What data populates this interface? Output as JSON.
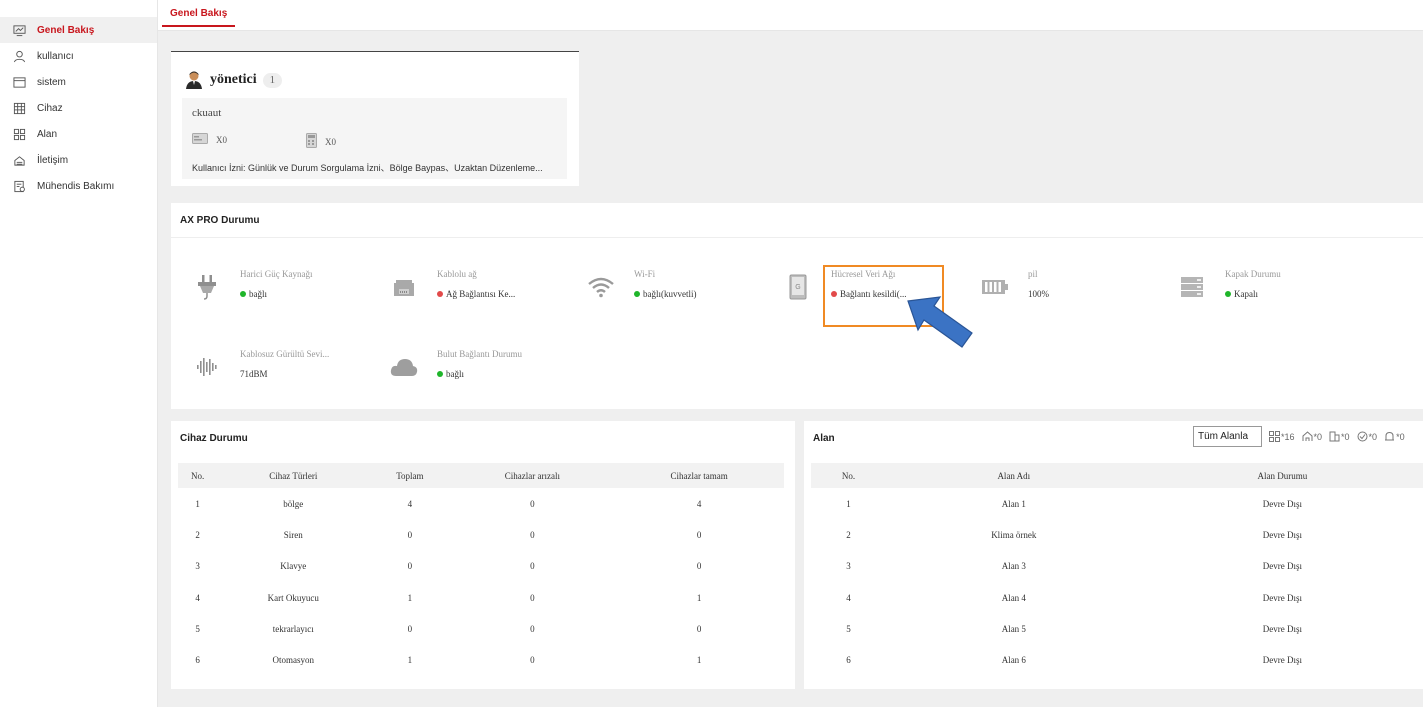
{
  "sidebar": {
    "items": [
      {
        "label": "Genel Bakış",
        "icon": "monitor-icon",
        "active": true
      },
      {
        "label": "kullanıcı",
        "icon": "user-icon"
      },
      {
        "label": "sistem",
        "icon": "window-icon"
      },
      {
        "label": "Cihaz",
        "icon": "device-icon"
      },
      {
        "label": "Alan",
        "icon": "grid-icon"
      },
      {
        "label": "İletişim",
        "icon": "communication-icon"
      },
      {
        "label": "Mühendis Bakımı",
        "icon": "maintenance-icon"
      }
    ]
  },
  "tabs": {
    "active": "Genel Bakış"
  },
  "user_card": {
    "role": "yönetici",
    "count": "1",
    "username": "ckuaut",
    "card_count": "X0",
    "keypad_count": "X0",
    "permission": "Kullanıcı İzni:  Günlük ve Durum Sorgulama İzni、Bölge Baypas、Uzaktan Düzenleme..."
  },
  "status": {
    "title": "AX PRO Durumu",
    "items": [
      {
        "label": "Harici Güç Kaynağı",
        "value": "bağlı",
        "dot": "green",
        "icon": "plug-icon"
      },
      {
        "label": "Kablolu ağ",
        "value": "Ağ Bağlantısı Ke...",
        "dot": "red",
        "icon": "ethernet-icon"
      },
      {
        "label": "Wi-Fi",
        "value": "bağlı(kuvvetli)",
        "dot": "green",
        "icon": "wifi-icon"
      },
      {
        "label": "Hücresel Veri Ağı",
        "value": "Bağlantı kesildi(...",
        "dot": "red",
        "icon": "sim-card-icon"
      },
      {
        "label": "pil",
        "value": "100%",
        "dot": "",
        "icon": "battery-icon"
      },
      {
        "label": "Kapak Durumu",
        "value": "Kapalı",
        "dot": "green",
        "icon": "cover-icon"
      },
      {
        "label": "Kablosuz Gürültü Sevi...",
        "value": "71dBM",
        "dot": "",
        "icon": "noise-icon"
      },
      {
        "label": "Bulut Bağlantı Durumu",
        "value": "bağlı",
        "dot": "green",
        "icon": "cloud-icon"
      }
    ]
  },
  "device_status": {
    "title": "Cihaz Durumu",
    "headers": [
      "No.",
      "Cihaz Türleri",
      "Toplam",
      "Cihazlar arızalı",
      "Cihazlar tamam"
    ],
    "rows": [
      [
        "1",
        "bölge",
        "4",
        "0",
        "4"
      ],
      [
        "2",
        "Siren",
        "0",
        "0",
        "0"
      ],
      [
        "3",
        "Klavye",
        "0",
        "0",
        "0"
      ],
      [
        "4",
        "Kart Okuyucu",
        "1",
        "0",
        "1"
      ],
      [
        "5",
        "tekrarlayıcı",
        "0",
        "0",
        "0"
      ],
      [
        "6",
        "Otomasyon",
        "1",
        "0",
        "1"
      ]
    ]
  },
  "area": {
    "title": "Alan",
    "filter": "Tüm Alanla",
    "counts": [
      "*16",
      "*0",
      "*0",
      "*0",
      "*0"
    ],
    "headers": [
      "No.",
      "Alan Adı",
      "Alan Durumu"
    ],
    "rows": [
      [
        "1",
        "Alan 1",
        "Devre Dışı"
      ],
      [
        "2",
        "Klima örnek",
        "Devre Dışı"
      ],
      [
        "3",
        "Alan 3",
        "Devre Dışı"
      ],
      [
        "4",
        "Alan 4",
        "Devre Dışı"
      ],
      [
        "5",
        "Alan 5",
        "Devre Dışı"
      ],
      [
        "6",
        "Alan 6",
        "Devre Dışı"
      ]
    ]
  },
  "colors": {
    "accent": "#c8161d",
    "highlight": "#f08a24",
    "arrow": "#3b73c4"
  }
}
